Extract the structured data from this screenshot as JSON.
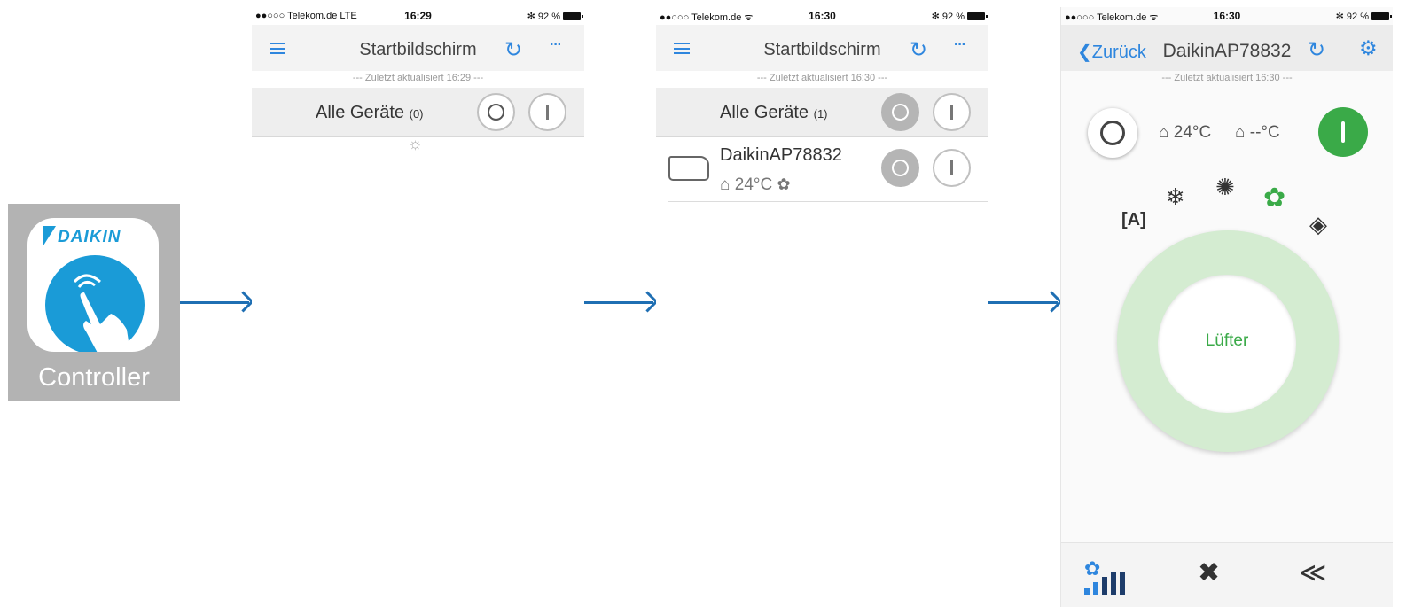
{
  "app_icon": {
    "brand": "DAIKIN",
    "label": "Controller",
    "brand_color": "#1a9bd7"
  },
  "screen1": {
    "status": {
      "carrier": "●●○○○ Telekom.de  LTE",
      "time": "16:29",
      "battery": "✻ 92 %"
    },
    "nav": {
      "title": "Startbildschirm",
      "menu_icon": "hamburger-icon",
      "refresh_icon": "↻",
      "more_icon": "···"
    },
    "updated": "--- Zuletzt aktualisiert 16:29 ---",
    "group": {
      "label": "Alle Geräte",
      "count": "(0)"
    },
    "spinner": "☼"
  },
  "screen2": {
    "status": {
      "carrier": "●●○○○ Telekom.de  ᯤ",
      "time": "16:30",
      "battery": "✻ 92 %"
    },
    "nav": {
      "title": "Startbildschirm",
      "refresh_icon": "↻",
      "more_icon": "···"
    },
    "updated": "--- Zuletzt aktualisiert 16:30 ---",
    "group": {
      "label": "Alle Geräte",
      "count": "(1)"
    },
    "device": {
      "name": "DaikinAP78832",
      "temp": "⌂ 24°C",
      "fan": "✿"
    }
  },
  "screen3": {
    "status": {
      "carrier": "●●○○○ Telekom.de  ᯤ",
      "time": "16:30",
      "battery": "✻ 92 %"
    },
    "nav": {
      "back": "❮Zurück",
      "title": "DaikinAP78832",
      "refresh_icon": "↻",
      "settings_icon": "⚙"
    },
    "updated": "--- Zuletzt aktualisiert 16:30 ---",
    "indoor_temp": "⌂ 24°C",
    "outdoor_temp": "⌂ --°C",
    "modes": {
      "auto": "[A]",
      "cool": "❄",
      "heat": "✺",
      "fan": "✿",
      "dry": "◈"
    },
    "active_mode": "fan",
    "dial_label": "Lüfter",
    "bottom": {
      "fan_speed": "✿",
      "fan_speed_levels": 4,
      "econo": "✖",
      "powerful": "≪"
    },
    "accent_green": "#3aaa48",
    "accent_blue": "#2e86de"
  }
}
